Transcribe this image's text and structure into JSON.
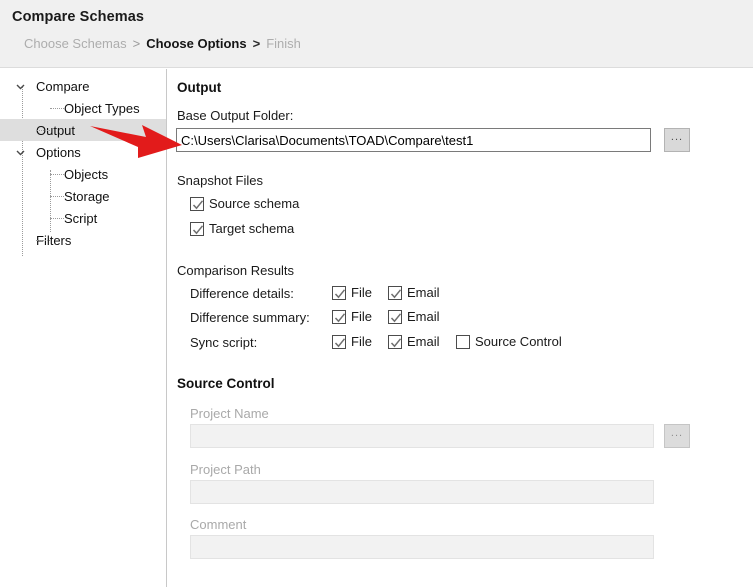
{
  "header": {
    "title": "Compare Schemas",
    "breadcrumb": [
      {
        "label": "Choose Schemas",
        "active": false
      },
      {
        "label": "Choose Options",
        "active": true
      },
      {
        "label": "Finish",
        "active": false
      }
    ],
    "separator": ">"
  },
  "sidebar": {
    "items": [
      {
        "label": "Compare",
        "level": 0,
        "expander": "chevron-down",
        "selected": false
      },
      {
        "label": "Object Types",
        "level": 1,
        "expander": "none",
        "selected": false
      },
      {
        "label": "Output",
        "level": 0,
        "expander": "none",
        "selected": true
      },
      {
        "label": "Options",
        "level": 0,
        "expander": "chevron-down",
        "selected": false
      },
      {
        "label": "Objects",
        "level": 1,
        "expander": "none",
        "selected": false
      },
      {
        "label": "Storage",
        "level": 1,
        "expander": "none",
        "selected": false
      },
      {
        "label": "Script",
        "level": 1,
        "expander": "none",
        "selected": false
      },
      {
        "label": "Filters",
        "level": 0,
        "expander": "none",
        "selected": false
      }
    ]
  },
  "main": {
    "section_title": "Output",
    "base_output_folder": {
      "label": "Base Output Folder:",
      "value": "C:\\Users\\Clarisa\\Documents\\TOAD\\Compare\\test1",
      "browse_label": "..."
    },
    "snapshot_files": {
      "title": "Snapshot Files",
      "options": [
        {
          "label": "Source schema",
          "checked": true
        },
        {
          "label": "Target schema",
          "checked": true
        }
      ]
    },
    "comparison_results": {
      "title": "Comparison Results",
      "rows": [
        {
          "label": "Difference details:",
          "options": [
            {
              "label": "File",
              "checked": true
            },
            {
              "label": "Email",
              "checked": true
            }
          ]
        },
        {
          "label": "Difference summary:",
          "options": [
            {
              "label": "File",
              "checked": true
            },
            {
              "label": "Email",
              "checked": true
            }
          ]
        },
        {
          "label": "Sync script:",
          "options": [
            {
              "label": "File",
              "checked": true
            },
            {
              "label": "Email",
              "checked": true
            },
            {
              "label": "Source Control",
              "checked": false
            }
          ]
        }
      ]
    },
    "source_control": {
      "title": "Source Control",
      "fields": [
        {
          "label": "Project Name",
          "value": "",
          "has_browse": true,
          "browse_label": "...",
          "disabled": true
        },
        {
          "label": "Project Path",
          "value": "",
          "has_browse": false,
          "disabled": true
        },
        {
          "label": "Comment",
          "value": "",
          "has_browse": false,
          "disabled": true
        }
      ]
    }
  },
  "annotation": {
    "arrow": "red-arrow-pointing-right",
    "color": "#e01b１b"
  },
  "colors": {
    "header_bg": "#f0f0f0",
    "selection_bg": "#dedede",
    "annotation_red": "#e21b1b",
    "disabled_text": "#a9a9a9"
  }
}
